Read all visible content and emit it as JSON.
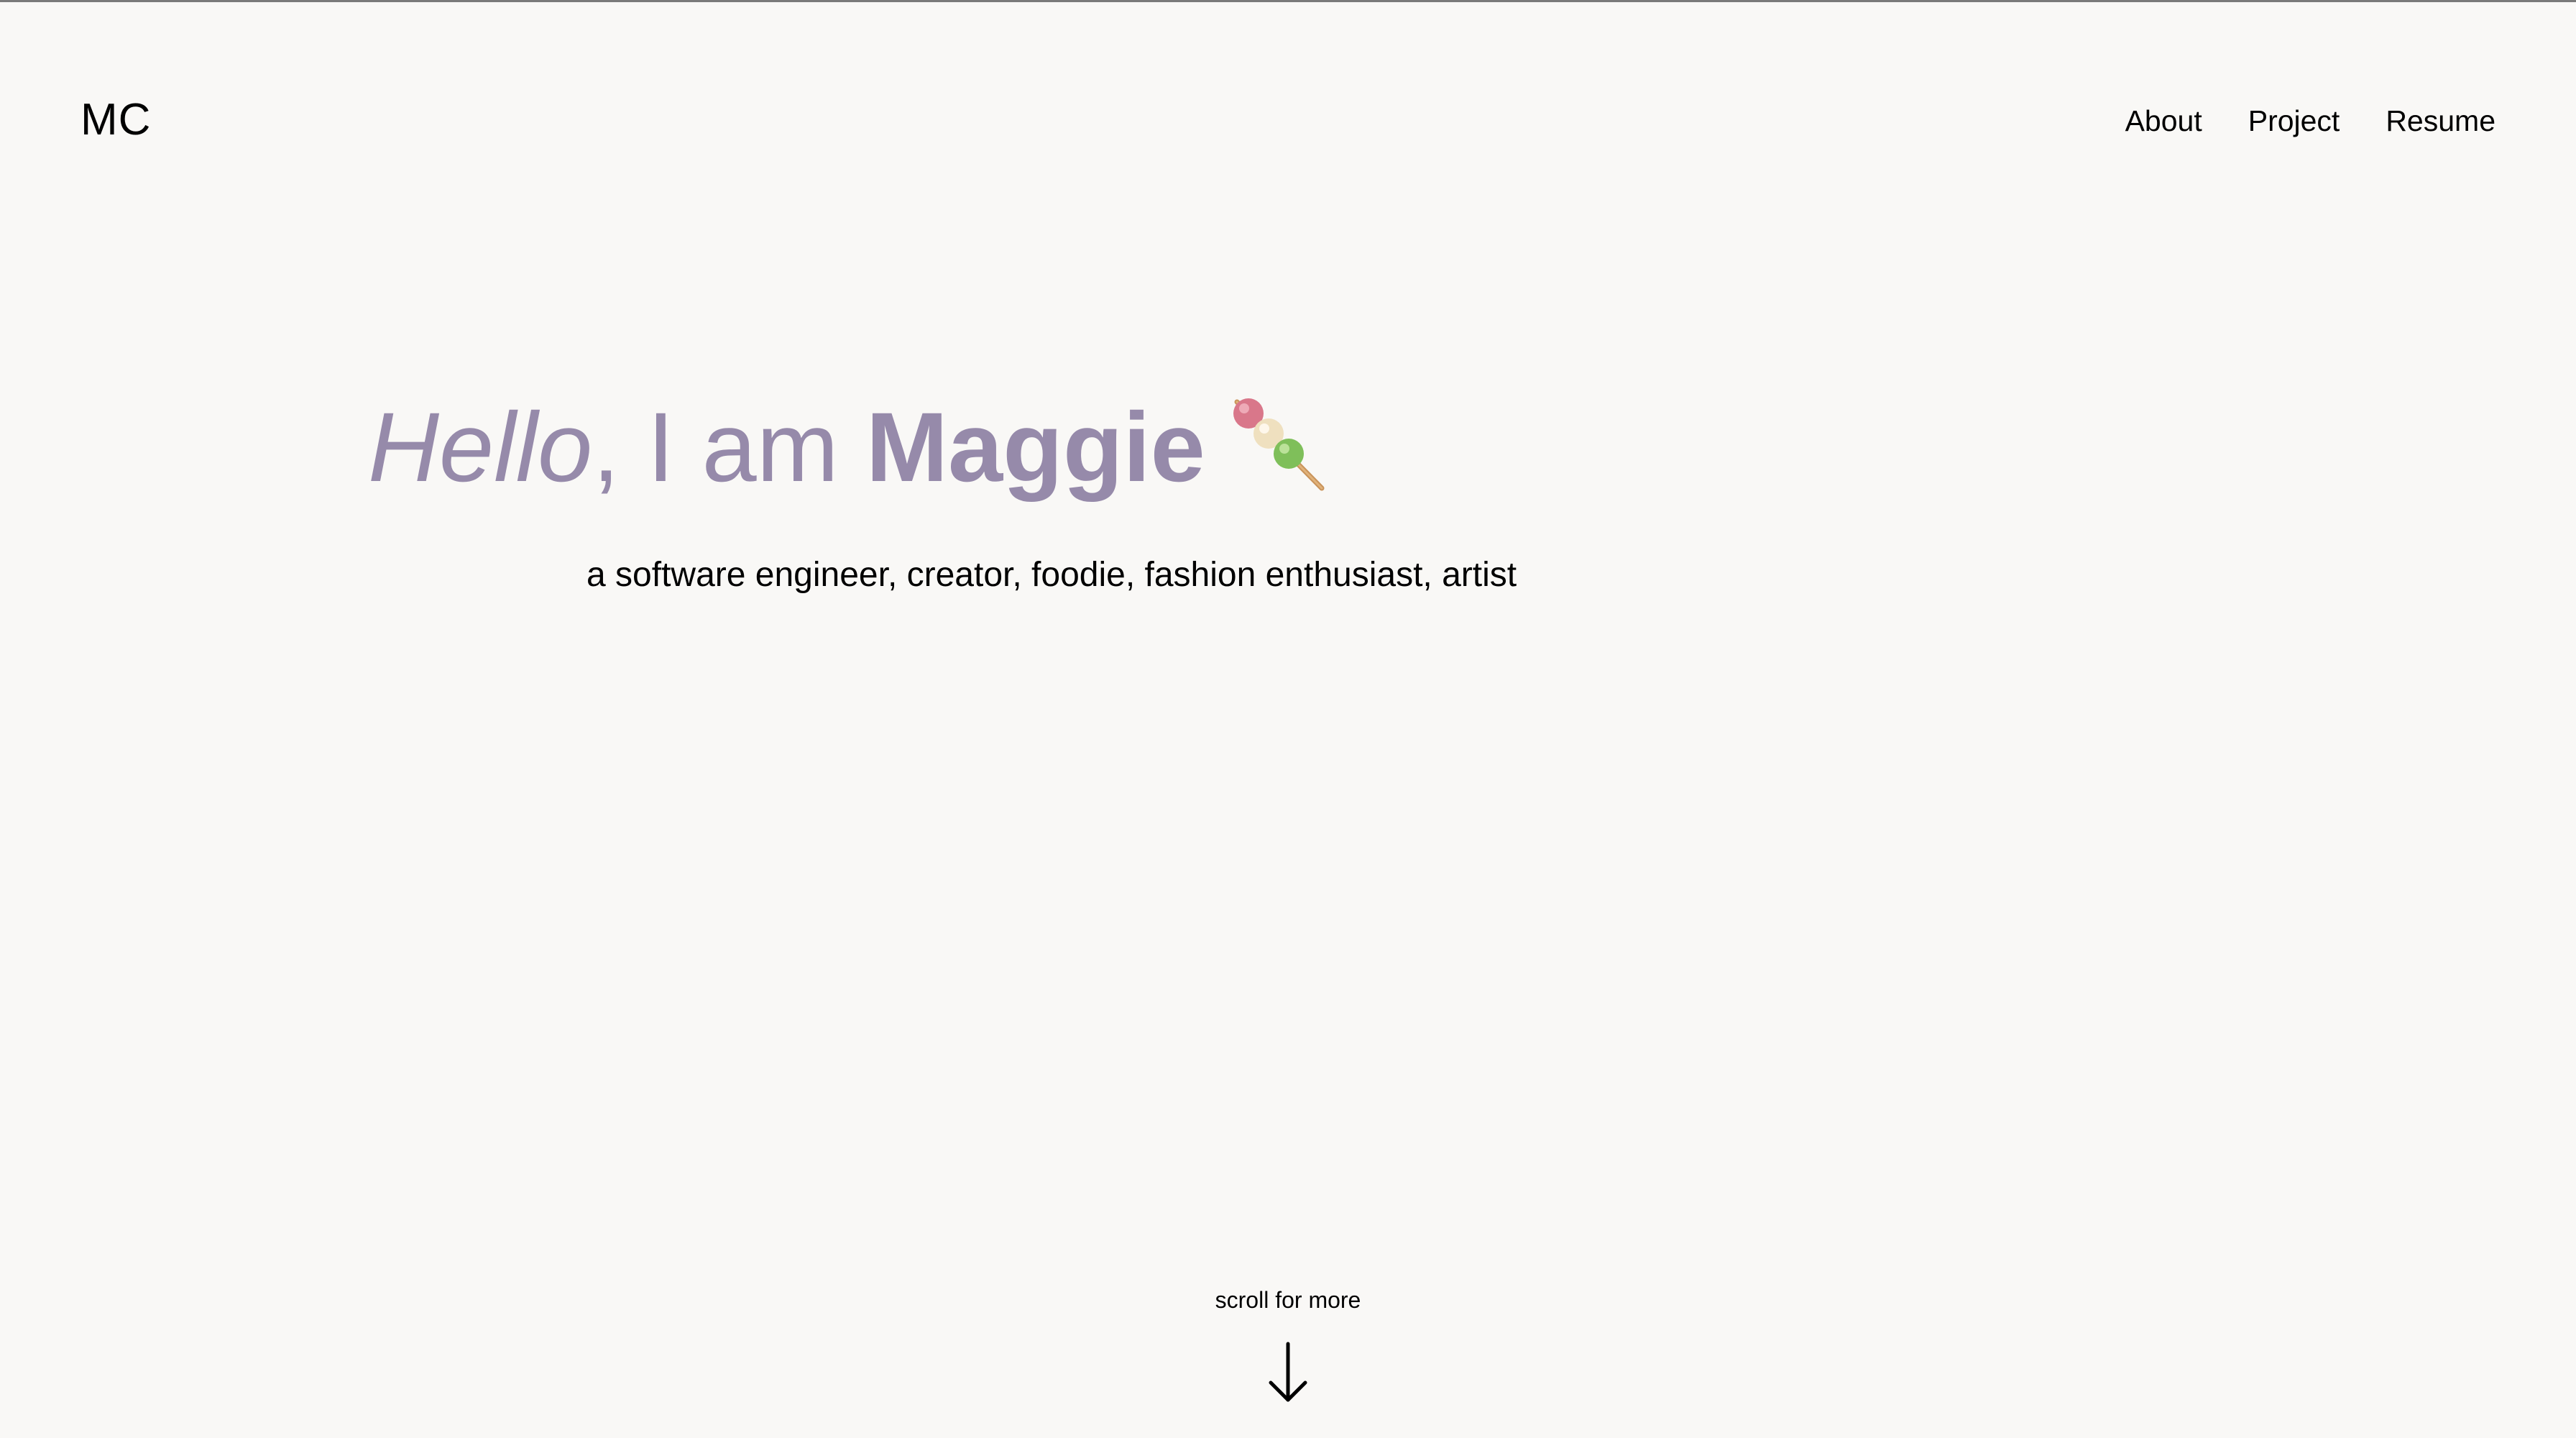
{
  "header": {
    "logo": "MC",
    "nav": [
      {
        "label": "About"
      },
      {
        "label": "Project"
      },
      {
        "label": "Resume"
      }
    ]
  },
  "hero": {
    "hello": "Hello",
    "middle": ", I am ",
    "name": "Maggie",
    "emoji_icon": "dango-icon",
    "subtitle": "a software engineer, creator, foodie, fashion enthusiast, artist",
    "accent_color": "#968aaa"
  },
  "scroll": {
    "label": "scroll for more",
    "icon": "arrow-down-icon"
  }
}
